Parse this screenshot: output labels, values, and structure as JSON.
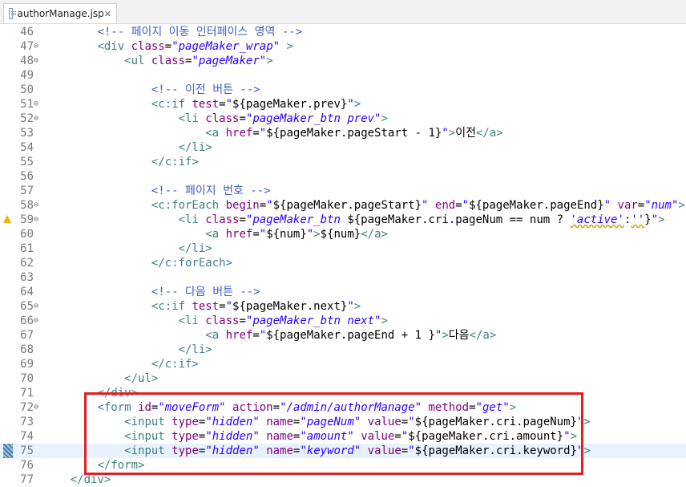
{
  "tab": {
    "name": "authorManage.jsp",
    "icon": "jsp-file-icon",
    "close": "✕"
  },
  "lines": [
    {
      "n": "46",
      "fold": "",
      "icon": "",
      "cur": false,
      "segs": [
        [
          "        ",
          "x"
        ],
        [
          "<!-- 페이지 이동 인터페이스 영역 -->",
          "c"
        ]
      ]
    },
    {
      "n": "47",
      "fold": "⊖",
      "icon": "",
      "cur": false,
      "segs": [
        [
          "        ",
          "x"
        ],
        [
          "<div ",
          "t"
        ],
        [
          "class",
          "a"
        ],
        [
          "=",
          "x"
        ],
        [
          "\"pageMaker_wrap\"",
          "v"
        ],
        [
          " >",
          "t"
        ]
      ]
    },
    {
      "n": "48",
      "fold": "⊖",
      "icon": "",
      "cur": false,
      "segs": [
        [
          "            ",
          "x"
        ],
        [
          "<ul ",
          "t"
        ],
        [
          "class",
          "a"
        ],
        [
          "=",
          "x"
        ],
        [
          "\"pageMaker\"",
          "v"
        ],
        [
          ">",
          "t"
        ]
      ]
    },
    {
      "n": "49",
      "fold": "",
      "icon": "",
      "cur": false,
      "segs": []
    },
    {
      "n": "50",
      "fold": "",
      "icon": "",
      "cur": false,
      "segs": [
        [
          "                ",
          "x"
        ],
        [
          "<!-- 이전 버튼 -->",
          "c"
        ]
      ]
    },
    {
      "n": "51",
      "fold": "⊖",
      "icon": "",
      "cur": false,
      "segs": [
        [
          "                ",
          "x"
        ],
        [
          "<c:if ",
          "t"
        ],
        [
          "test",
          "a"
        ],
        [
          "=",
          "x"
        ],
        [
          "\"",
          "v"
        ],
        [
          "${pageMaker.prev}",
          "x"
        ],
        [
          "\"",
          "v"
        ],
        [
          ">",
          "t"
        ]
      ]
    },
    {
      "n": "52",
      "fold": "⊖",
      "icon": "",
      "cur": false,
      "segs": [
        [
          "                    ",
          "x"
        ],
        [
          "<li ",
          "t"
        ],
        [
          "class",
          "a"
        ],
        [
          "=",
          "x"
        ],
        [
          "\"pageMaker_btn prev\"",
          "v"
        ],
        [
          ">",
          "t"
        ]
      ]
    },
    {
      "n": "53",
      "fold": "",
      "icon": "",
      "cur": false,
      "segs": [
        [
          "                        ",
          "x"
        ],
        [
          "<a ",
          "t"
        ],
        [
          "href",
          "a"
        ],
        [
          "=",
          "x"
        ],
        [
          "\"",
          "v"
        ],
        [
          "${pageMaker.pageStart - 1}",
          "x"
        ],
        [
          "\"",
          "v"
        ],
        [
          ">",
          "t"
        ],
        [
          "이전",
          "x"
        ],
        [
          "</a>",
          "t"
        ]
      ]
    },
    {
      "n": "54",
      "fold": "",
      "icon": "",
      "cur": false,
      "segs": [
        [
          "                    ",
          "x"
        ],
        [
          "</li>",
          "t"
        ]
      ]
    },
    {
      "n": "55",
      "fold": "",
      "icon": "",
      "cur": false,
      "segs": [
        [
          "                ",
          "x"
        ],
        [
          "</c:if>",
          "t"
        ]
      ]
    },
    {
      "n": "56",
      "fold": "",
      "icon": "",
      "cur": false,
      "segs": []
    },
    {
      "n": "57",
      "fold": "",
      "icon": "",
      "cur": false,
      "segs": [
        [
          "                ",
          "x"
        ],
        [
          "<!-- 페이지 번호 -->",
          "c"
        ]
      ]
    },
    {
      "n": "58",
      "fold": "⊖",
      "icon": "",
      "cur": false,
      "segs": [
        [
          "                ",
          "x"
        ],
        [
          "<c:forEach ",
          "t"
        ],
        [
          "begin",
          "a"
        ],
        [
          "=",
          "x"
        ],
        [
          "\"",
          "v"
        ],
        [
          "${pageMaker.pageStart}",
          "x"
        ],
        [
          "\"",
          "v"
        ],
        [
          " end",
          "a"
        ],
        [
          "=",
          "x"
        ],
        [
          "\"",
          "v"
        ],
        [
          "${pageMaker.pageEnd}",
          "x"
        ],
        [
          "\"",
          "v"
        ],
        [
          " var",
          "a"
        ],
        [
          "=",
          "x"
        ],
        [
          "\"num\"",
          "v"
        ],
        [
          ">",
          "t"
        ]
      ]
    },
    {
      "n": "59",
      "fold": "⊖",
      "icon": "warning",
      "cur": false,
      "segs": [
        [
          "                    ",
          "x"
        ],
        [
          "<li ",
          "t"
        ],
        [
          "class",
          "a"
        ],
        [
          "=",
          "x"
        ],
        [
          "\"pageMaker_btn ",
          "v"
        ],
        [
          "${pageMaker.cri.pageNum == num ? ",
          "x"
        ],
        [
          "'active'",
          "vu"
        ],
        [
          ":",
          "x"
        ],
        [
          "''",
          "vu"
        ],
        [
          "}",
          "x"
        ],
        [
          "\"",
          "v"
        ],
        [
          ">",
          "t"
        ]
      ]
    },
    {
      "n": "60",
      "fold": "",
      "icon": "",
      "cur": false,
      "segs": [
        [
          "                        ",
          "x"
        ],
        [
          "<a ",
          "t"
        ],
        [
          "href",
          "a"
        ],
        [
          "=",
          "x"
        ],
        [
          "\"",
          "v"
        ],
        [
          "${num}",
          "x"
        ],
        [
          "\"",
          "v"
        ],
        [
          ">",
          "t"
        ],
        [
          "${num}",
          "x"
        ],
        [
          "</a>",
          "t"
        ]
      ]
    },
    {
      "n": "61",
      "fold": "",
      "icon": "",
      "cur": false,
      "segs": [
        [
          "                    ",
          "x"
        ],
        [
          "</li>",
          "t"
        ]
      ]
    },
    {
      "n": "62",
      "fold": "",
      "icon": "",
      "cur": false,
      "segs": [
        [
          "                ",
          "x"
        ],
        [
          "</c:forEach>",
          "t"
        ]
      ]
    },
    {
      "n": "63",
      "fold": "",
      "icon": "",
      "cur": false,
      "segs": []
    },
    {
      "n": "64",
      "fold": "",
      "icon": "",
      "cur": false,
      "segs": [
        [
          "                ",
          "x"
        ],
        [
          "<!-- 다음 버튼 -->",
          "c"
        ]
      ]
    },
    {
      "n": "65",
      "fold": "⊖",
      "icon": "",
      "cur": false,
      "segs": [
        [
          "                ",
          "x"
        ],
        [
          "<c:if ",
          "t"
        ],
        [
          "test",
          "a"
        ],
        [
          "=",
          "x"
        ],
        [
          "\"",
          "v"
        ],
        [
          "${pageMaker.next}",
          "x"
        ],
        [
          "\"",
          "v"
        ],
        [
          ">",
          "t"
        ]
      ]
    },
    {
      "n": "66",
      "fold": "⊖",
      "icon": "",
      "cur": false,
      "segs": [
        [
          "                    ",
          "x"
        ],
        [
          "<li ",
          "t"
        ],
        [
          "class",
          "a"
        ],
        [
          "=",
          "x"
        ],
        [
          "\"pageMaker_btn next\"",
          "v"
        ],
        [
          ">",
          "t"
        ]
      ]
    },
    {
      "n": "67",
      "fold": "",
      "icon": "",
      "cur": false,
      "segs": [
        [
          "                        ",
          "x"
        ],
        [
          "<a ",
          "t"
        ],
        [
          "href",
          "a"
        ],
        [
          "=",
          "x"
        ],
        [
          "\"",
          "v"
        ],
        [
          "${pageMaker.pageEnd + 1 }",
          "x"
        ],
        [
          "\"",
          "v"
        ],
        [
          ">",
          "t"
        ],
        [
          "다음",
          "x"
        ],
        [
          "</a>",
          "t"
        ]
      ]
    },
    {
      "n": "68",
      "fold": "",
      "icon": "",
      "cur": false,
      "segs": [
        [
          "                    ",
          "x"
        ],
        [
          "</li>",
          "t"
        ]
      ]
    },
    {
      "n": "69",
      "fold": "",
      "icon": "",
      "cur": false,
      "segs": [
        [
          "                ",
          "x"
        ],
        [
          "</c:if>",
          "t"
        ]
      ]
    },
    {
      "n": "70",
      "fold": "",
      "icon": "",
      "cur": false,
      "segs": [
        [
          "            ",
          "x"
        ],
        [
          "</ul>",
          "t"
        ]
      ]
    },
    {
      "n": "71",
      "fold": "",
      "icon": "",
      "cur": false,
      "segs": [
        [
          "        ",
          "x"
        ],
        [
          "</div>",
          "t"
        ]
      ]
    },
    {
      "n": "72",
      "fold": "⊖",
      "icon": "",
      "cur": false,
      "segs": [
        [
          "        ",
          "x"
        ],
        [
          "<form ",
          "t"
        ],
        [
          "id",
          "a"
        ],
        [
          "=",
          "x"
        ],
        [
          "\"moveForm\"",
          "v"
        ],
        [
          " action",
          "a"
        ],
        [
          "=",
          "x"
        ],
        [
          "\"/admin/authorManage\"",
          "v"
        ],
        [
          " method",
          "a"
        ],
        [
          "=",
          "x"
        ],
        [
          "\"get\"",
          "v"
        ],
        [
          ">",
          "t"
        ]
      ]
    },
    {
      "n": "73",
      "fold": "",
      "icon": "",
      "cur": false,
      "segs": [
        [
          "            ",
          "x"
        ],
        [
          "<input ",
          "t"
        ],
        [
          "type",
          "a"
        ],
        [
          "=",
          "x"
        ],
        [
          "\"hidden\"",
          "v"
        ],
        [
          " name",
          "a"
        ],
        [
          "=",
          "x"
        ],
        [
          "\"pageNum\"",
          "v"
        ],
        [
          " value",
          "a"
        ],
        [
          "=",
          "x"
        ],
        [
          "\"",
          "v"
        ],
        [
          "${pageMaker.cri.pageNum}",
          "x"
        ],
        [
          "\"",
          "v"
        ],
        [
          ">",
          "t"
        ]
      ]
    },
    {
      "n": "74",
      "fold": "",
      "icon": "",
      "cur": false,
      "segs": [
        [
          "            ",
          "x"
        ],
        [
          "<input ",
          "t"
        ],
        [
          "type",
          "a"
        ],
        [
          "=",
          "x"
        ],
        [
          "\"hidden\"",
          "v"
        ],
        [
          " name",
          "a"
        ],
        [
          "=",
          "x"
        ],
        [
          "\"amount\"",
          "v"
        ],
        [
          " value",
          "a"
        ],
        [
          "=",
          "x"
        ],
        [
          "\"",
          "v"
        ],
        [
          "${pageMaker.cri.amount}",
          "x"
        ],
        [
          "\"",
          "v"
        ],
        [
          ">",
          "t"
        ]
      ]
    },
    {
      "n": "75",
      "fold": "",
      "icon": "marker",
      "cur": true,
      "segs": [
        [
          "            ",
          "x"
        ],
        [
          "<input ",
          "t"
        ],
        [
          "type",
          "a"
        ],
        [
          "=",
          "x"
        ],
        [
          "\"hidden\"",
          "v"
        ],
        [
          " name",
          "a"
        ],
        [
          "=",
          "x"
        ],
        [
          "\"keyword\"",
          "v"
        ],
        [
          " value",
          "a"
        ],
        [
          "=",
          "x"
        ],
        [
          "\"",
          "v"
        ],
        [
          "${pageMaker.cri.keyword}",
          "x"
        ],
        [
          "\"",
          "v"
        ],
        [
          ">",
          "t"
        ]
      ]
    },
    {
      "n": "76",
      "fold": "",
      "icon": "",
      "cur": false,
      "segs": [
        [
          "        ",
          "x"
        ],
        [
          "</form>",
          "t"
        ]
      ]
    },
    {
      "n": "77",
      "fold": "",
      "icon": "",
      "cur": false,
      "segs": [
        [
          "    ",
          "x"
        ],
        [
          "</div>",
          "t"
        ]
      ]
    }
  ]
}
